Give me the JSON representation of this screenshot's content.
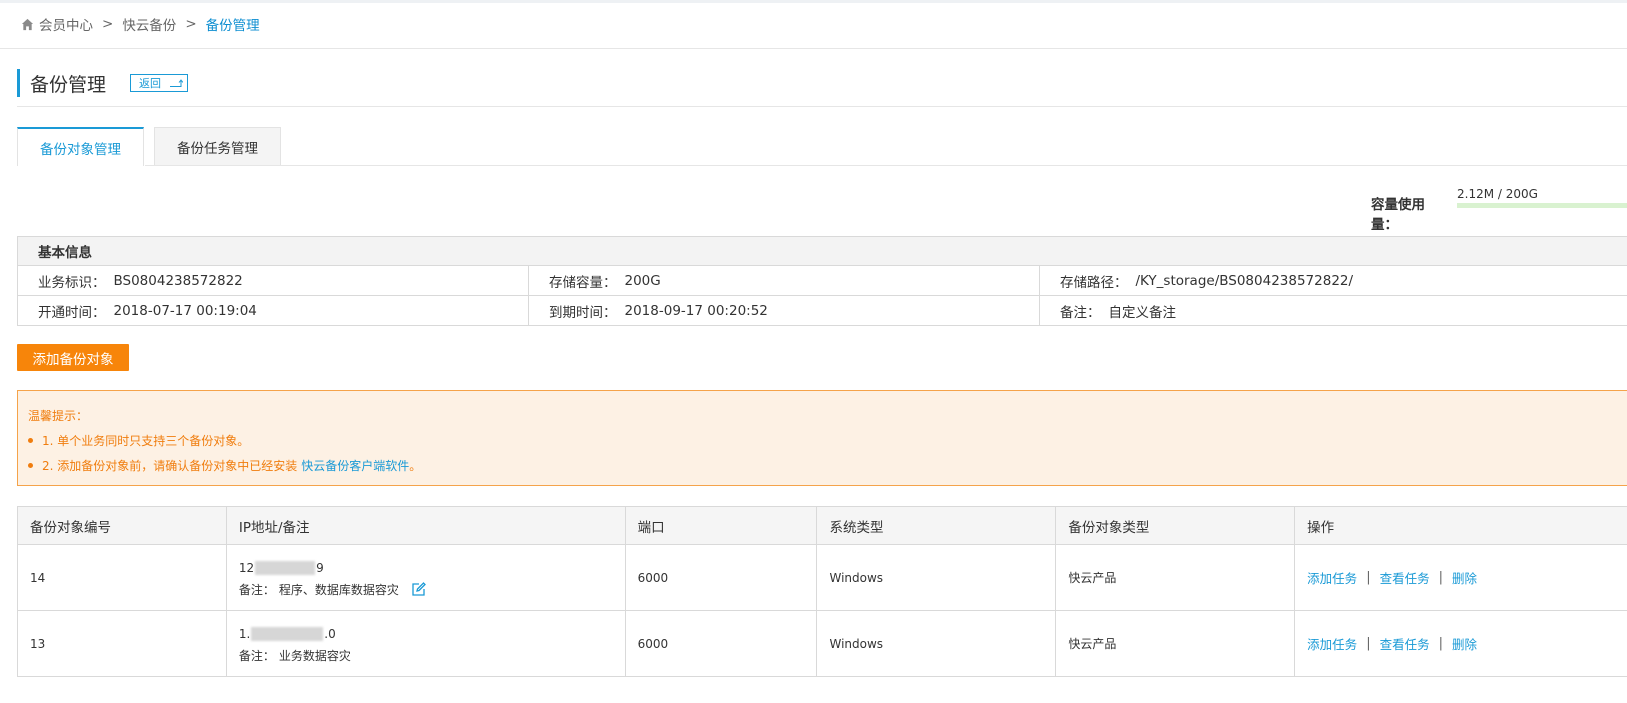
{
  "breadcrumb": [
    "会员中心",
    "快云备份",
    "备份管理"
  ],
  "breadcrumb_sep": ">",
  "page_title": "备份管理",
  "back_button": "返回",
  "tabs": [
    {
      "label": "备份对象管理",
      "active": true
    },
    {
      "label": "备份任务管理",
      "active": false
    }
  ],
  "usage": {
    "label": "容量使用量：",
    "value": "2.12M / 200G",
    "fraction": 1e-05
  },
  "basic_info": {
    "title": "基本信息",
    "rows": [
      [
        {
          "key": "业务标识：",
          "value": "BS0804238572822"
        },
        {
          "key": "存储容量：",
          "value": "200G"
        },
        {
          "key": "存储路径：",
          "value": "/KY_storage/BS0804238572822/"
        }
      ],
      [
        {
          "key": "开通时间：",
          "value": "2018-07-17 00:19:04"
        },
        {
          "key": "到期时间：",
          "value": "2018-09-17 00:20:52"
        },
        {
          "key": "备注：",
          "value": "自定义备注"
        }
      ]
    ]
  },
  "add_button": "添加备份对象",
  "tips": {
    "title": "温馨提示：",
    "item1": "1. 单个业务同时只支持三个备份对象。",
    "item2_prefix": "2. 添加备份对象前，请确认备份对象中已经安装",
    "item2_link": "快云备份客户端软件",
    "item2_suffix": "。"
  },
  "table": {
    "headers": [
      "备份对象编号",
      "IP地址/备注",
      "端口",
      "系统类型",
      "备份对象类型",
      "操作"
    ],
    "rows": [
      {
        "id": "14",
        "ip_start": "12",
        "ip_end": "9",
        "note_label": "备注：",
        "note": "程序、数据库数据容灾",
        "port": "6000",
        "os": "Windows",
        "type": "快云产品"
      },
      {
        "id": "13",
        "ip_start": "1.",
        "ip_end": ".0",
        "note_label": "备注：",
        "note": "业务数据容灾",
        "port": "6000",
        "os": "Windows",
        "type": "快云产品"
      }
    ],
    "ops": {
      "add": "添加任务",
      "view": "查看任务",
      "delete": "删除",
      "sep": "|"
    }
  },
  "colors": {
    "accent": "#1a9ad6",
    "orange": "#f7850a",
    "tip_text": "#f07d0e",
    "tip_bg": "#fdf1e4",
    "usage_bar": "#5cc24a"
  },
  "icons": [
    "home-icon",
    "back-arrow-icon",
    "edit-icon"
  ]
}
